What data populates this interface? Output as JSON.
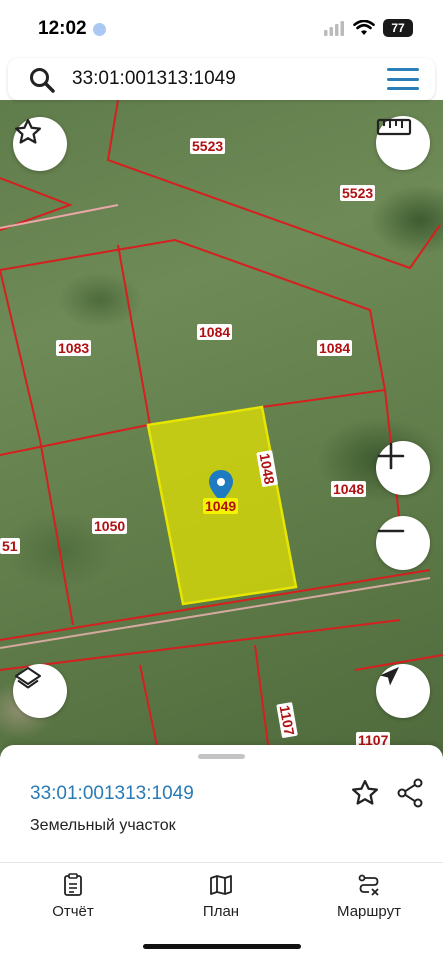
{
  "status_bar": {
    "time": "12:02",
    "battery": "77"
  },
  "search": {
    "value": "33:01:001313:1049"
  },
  "map": {
    "colors": {
      "boundary": "#d61f1f",
      "selected_fill": "#e6e600",
      "marker": "#1f7bc0"
    },
    "parcel_labels": {
      "p5523a": "5523",
      "p5523b": "5523",
      "p1083": "1083",
      "p1084a": "1084",
      "p1084b": "1084",
      "p1048a": "1048",
      "p1048b": "1048",
      "p1050": "1050",
      "p51": "51",
      "p1049": "1049",
      "p1107a": "1107",
      "p1107b": "1107"
    }
  },
  "sheet": {
    "parcel_id": "33:01:001313:1049",
    "parcel_type": "Земельный участок"
  },
  "tabs": [
    {
      "label": "Отчёт",
      "icon": "report-icon"
    },
    {
      "label": "План",
      "icon": "map-icon"
    },
    {
      "label": "Маршрут",
      "icon": "route-icon"
    }
  ]
}
